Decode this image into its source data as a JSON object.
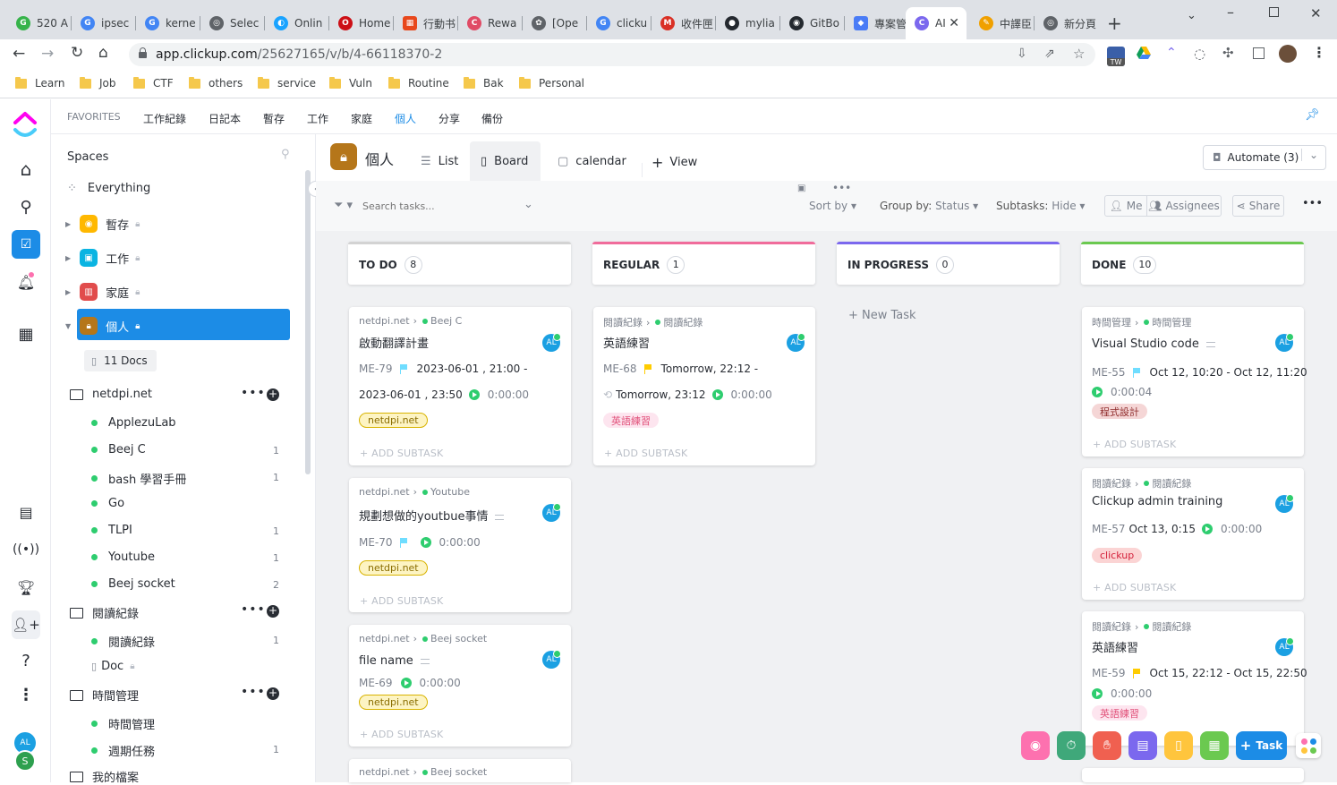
{
  "browser": {
    "tabs": [
      {
        "title": "520 A",
        "color": "#36b34a"
      },
      {
        "title": "ipsec",
        "color": "#4285f4"
      },
      {
        "title": "kerne",
        "color": "#4285f4"
      },
      {
        "title": "Selec",
        "color": "#5f6368"
      },
      {
        "title": "Onlin",
        "color": "#1aa3ff"
      },
      {
        "title": "Home",
        "color": "#cc0f16"
      },
      {
        "title": "行動书",
        "color": "#e8481c"
      },
      {
        "title": "Rewa",
        "color": "#e04b65"
      },
      {
        "title": "[Ope",
        "color": "#5f6368"
      },
      {
        "title": "clicku",
        "color": "#4285f4"
      },
      {
        "title": "收件匣",
        "color": "#d93025"
      },
      {
        "title": "mylia",
        "color": "#24292f"
      },
      {
        "title": "GitBo",
        "color": "#24292f"
      },
      {
        "title": "專案管",
        "color": "#4a7cf6"
      },
      {
        "title": "AI",
        "color": "#7b68ee"
      },
      {
        "title": "中譯臣",
        "color": "#f0a000"
      },
      {
        "title": "新分頁",
        "color": "#5f6368"
      }
    ],
    "url_host": "app.clickup.com",
    "url_path": "/25627165/v/b/4-66118370-2",
    "ext_badge": "TW",
    "bookmarks": [
      "Learn",
      "Job",
      "CTF",
      "others",
      "service",
      "Vuln",
      "Routine",
      "Bak",
      "Personal"
    ]
  },
  "favorites": {
    "label": "FAVORITES",
    "items": [
      "工作紀錄",
      "日記本",
      "暫存",
      "工作",
      "家庭",
      "個人",
      "分享",
      "備份"
    ]
  },
  "sidebar": {
    "title": "Spaces",
    "everything": "Everything",
    "spaces": [
      "暫存",
      "工作",
      "家庭",
      "個人"
    ],
    "docs": "11 Docs",
    "folders": [
      {
        "name": "netdpi.net",
        "lists": [
          {
            "name": "ApplezuLab",
            "count": ""
          },
          {
            "name": "Beej C",
            "count": "1"
          },
          {
            "name": "bash 學習手冊",
            "count": "1"
          },
          {
            "name": "Go",
            "count": ""
          },
          {
            "name": "TLPI",
            "count": "1"
          },
          {
            "name": "Youtube",
            "count": "1"
          },
          {
            "name": "Beej socket",
            "count": "2"
          }
        ]
      },
      {
        "name": "閱讀紀錄",
        "lists": [
          {
            "name": "閱讀紀錄",
            "count": "1"
          }
        ],
        "doc": "Doc"
      },
      {
        "name": "時間管理",
        "lists": [
          {
            "name": "時間管理",
            "count": ""
          },
          {
            "name": "週期任務",
            "count": "1"
          }
        ]
      },
      {
        "name": "我的檔案",
        "lists": []
      }
    ]
  },
  "view": {
    "title": "個人",
    "tabs": [
      "List",
      "Board",
      "calendar"
    ],
    "add_view": "View",
    "automate": "Automate (3)",
    "search_placeholder": "Search tasks...",
    "sort": "Sort by",
    "group_label": "Group by:",
    "group_value": "Status",
    "subtasks_label": "Subtasks:",
    "subtasks_value": "Hide",
    "me": "Me",
    "assignees": "Assignees",
    "share": "Share"
  },
  "columns": [
    {
      "name": "TO DO",
      "count": "8",
      "color": "#d3d3d3"
    },
    {
      "name": "REGULAR",
      "count": "1",
      "color": "#f06c9b"
    },
    {
      "name": "IN PROGRESS",
      "count": "0",
      "color": "#7b68ee"
    },
    {
      "name": "DONE",
      "count": "10",
      "color": "#6bc950"
    }
  ],
  "new_task": "+ New Task",
  "add_subtask": "+ ADD SUBTASK",
  "avatar": "AL",
  "cards": {
    "c1": {
      "crumb1": "netdpi.net",
      "crumb2": "Beej C",
      "title": "啟動翻譯計畫",
      "id": "ME-79",
      "date1": "2023-06-01 , 21:00 -",
      "date2": "2023-06-01 , 23:50",
      "time": "0:00:00",
      "tag": "netdpi.net"
    },
    "c2": {
      "crumb1": "netdpi.net",
      "crumb2": "Youtube",
      "title": "規劃想做的youtbue事情",
      "id": "ME-70",
      "time": "0:00:00",
      "tag": "netdpi.net"
    },
    "c3": {
      "crumb1": "netdpi.net",
      "crumb2": "Beej socket",
      "title": "file name",
      "id": "ME-69",
      "time": "0:00:00",
      "tag": "netdpi.net"
    },
    "c4": {
      "crumb1": "netdpi.net",
      "crumb2": "Beej socket"
    },
    "c5": {
      "crumb1": "閱讀紀錄",
      "crumb2": "閱讀紀錄",
      "title": "英語練習",
      "id": "ME-68",
      "date1": "Tomorrow, 22:12 -",
      "date2": "Tomorrow, 23:12",
      "time": "0:00:00",
      "tag": "英語練習"
    },
    "c6": {
      "crumb1": "時間管理",
      "crumb2": "時間管理",
      "title": "Visual Studio code",
      "id": "ME-55",
      "date1": "Oct 12, 10:20 - Oct 12, 11:20",
      "time": "0:00:04",
      "tag": "程式設計"
    },
    "c7": {
      "crumb1": "閱讀紀錄",
      "crumb2": "閱讀紀錄",
      "title": "Clickup admin training",
      "id": "ME-57",
      "date1": "Oct 13, 0:15",
      "time": "0:00:00",
      "tag": "clickup"
    },
    "c8": {
      "crumb1": "閱讀紀錄",
      "crumb2": "閱讀紀錄",
      "title": "英語練習",
      "id": "ME-59",
      "date1": "Oct 15, 22:12 - Oct 15, 22:50",
      "time": "0:00:00",
      "tag": "英語練習"
    }
  },
  "fab_task": "Task",
  "user_initial": "S"
}
